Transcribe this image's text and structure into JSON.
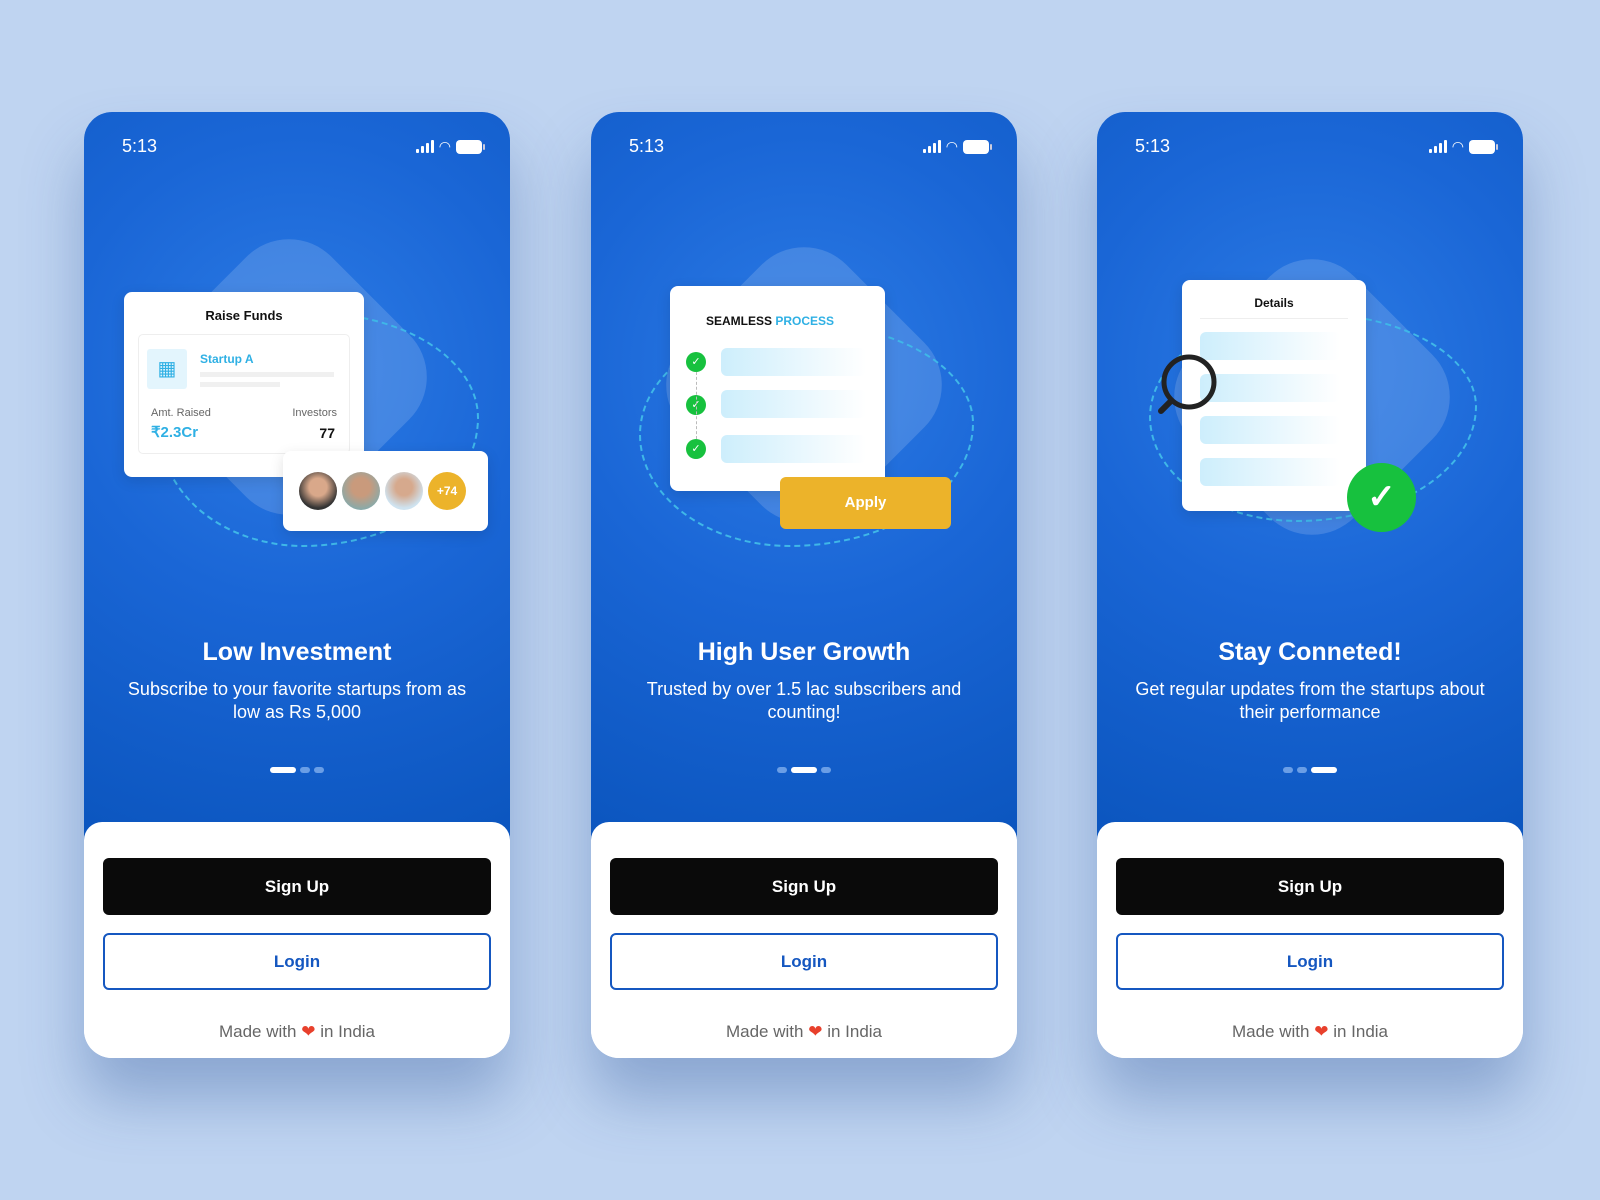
{
  "status": {
    "time": "5:13"
  },
  "screens": [
    {
      "title": "Low Investment",
      "subtitle": "Subscribe to your favorite startups from as low as Rs 5,000",
      "active_dot": 0,
      "card": {
        "heading": "Raise Funds",
        "startup": "Startup A",
        "amt_label": "Amt. Raised",
        "amt_value": "₹2.3Cr",
        "inv_label": "Investors",
        "inv_value": "77",
        "more": "+74"
      }
    },
    {
      "title": "High User Growth",
      "subtitle": "Trusted by over 1.5 lac subscribers and counting!",
      "active_dot": 1,
      "card": {
        "heading_a": "SEAMLESS",
        "heading_b": "PROCESS",
        "apply": "Apply"
      }
    },
    {
      "title": "Stay Conneted!",
      "subtitle": "Get regular updates from the startups about their performance",
      "active_dot": 2,
      "card": {
        "heading": "Details"
      }
    }
  ],
  "actions": {
    "signup": "Sign Up",
    "login": "Login"
  },
  "footer": {
    "made_with": "Made with",
    "heart": "❤",
    "in_india": "in India"
  },
  "colors": {
    "primary": "#1557c0",
    "accent_yellow": "#ecb32a",
    "success": "#17c13e",
    "cyan": "#2fb0e4"
  }
}
